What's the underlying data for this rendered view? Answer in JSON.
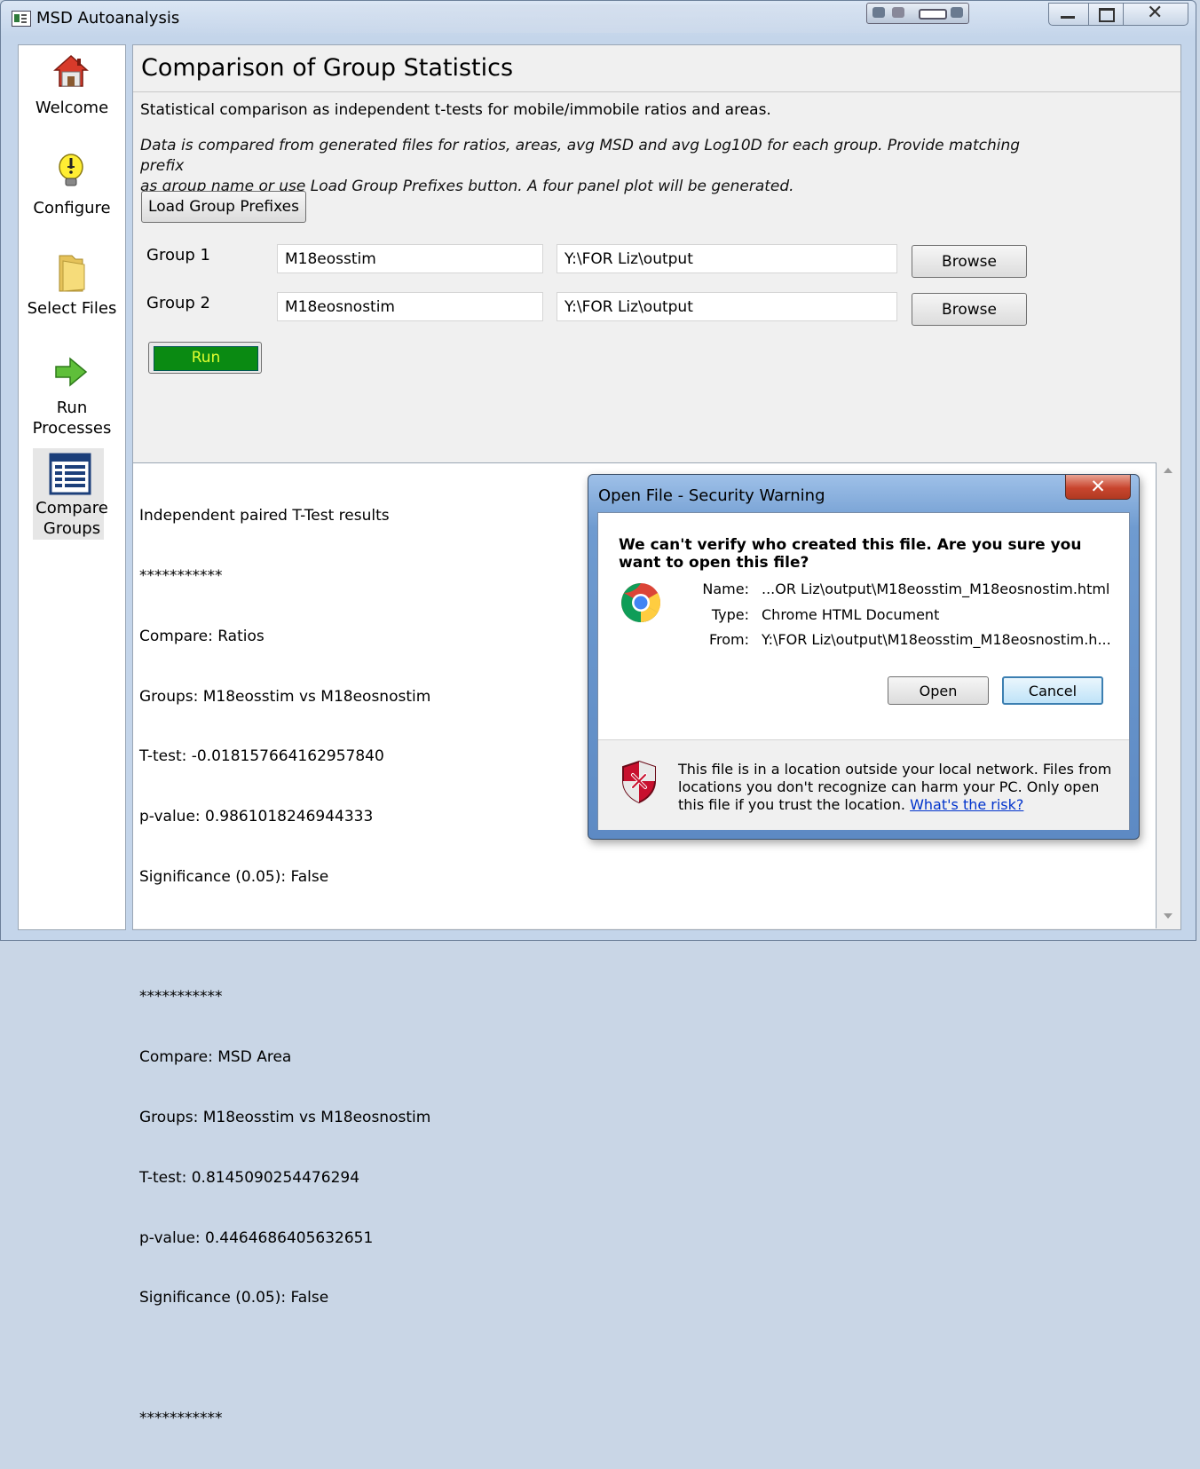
{
  "window": {
    "title": "MSD Autoanalysis"
  },
  "sidebar": {
    "items": [
      {
        "label": "Welcome",
        "icon": "house-icon"
      },
      {
        "label": "Configure",
        "icon": "lightbulb-icon"
      },
      {
        "label": "Select Files",
        "icon": "folder-icon"
      },
      {
        "label_line1": "Run",
        "label_line2": "Processes",
        "icon": "arrow-right-icon"
      },
      {
        "label_line1": "Compare",
        "label_line2": "Groups",
        "icon": "table-icon"
      }
    ]
  },
  "page": {
    "title": "Comparison of Group Statistics",
    "description": "Statistical comparison as independent t-tests for mobile/immobile ratios and areas.",
    "description_italic_line1": "Data is compared from generated files for ratios, areas, avg MSD and avg Log10D for each group. Provide matching prefix",
    "description_italic_line2": "as group name or use Load Group Prefixes button. A four panel plot will be generated.",
    "load_prefixes_label": "Load Group Prefixes",
    "groups": [
      {
        "label": "Group 1",
        "prefix": "M18eosstim",
        "folder": "Y:\\FOR Liz\\output",
        "browse_label": "Browse"
      },
      {
        "label": "Group 2",
        "prefix": "M18eosnostim",
        "folder": "Y:\\FOR Liz\\output",
        "browse_label": "Browse"
      }
    ],
    "run_label": "Run"
  },
  "output": {
    "lines": [
      "Independent paired T-Test results",
      "***********",
      "Compare: Ratios",
      "Groups: M18eosstim vs M18eosnostim",
      "T-test: -0.018157664162957840",
      "p-value: 0.9861018246944333",
      "Significance (0.05): False",
      "",
      "***********",
      "Compare: MSD Area",
      "Groups: M18eosstim vs M18eosnostim",
      "T-test: 0.8145090254476294",
      "p-value: 0.4464686405632651",
      "Significance (0.05): False",
      "",
      "***********"
    ]
  },
  "dialog": {
    "title": "Open File - Security Warning",
    "question": "We can't verify who created this file. Are you sure you want to open this file?",
    "name_key": "Name:",
    "name_value": "...OR Liz\\output\\M18eosstim_M18eosnostim.html",
    "type_key": "Type:",
    "type_value": "Chrome HTML Document",
    "from_key": "From:",
    "from_value": "Y:\\FOR Liz\\output\\M18eosstim_M18eosnostim.h...",
    "open_label": "Open",
    "cancel_label": "Cancel",
    "warning_text": "This file is in a location outside your local network. Files from locations you don't recognize can harm your PC. Only open this file if you trust the location.",
    "risk_link": "What's the risk?",
    "close_glyph": "✕"
  },
  "colors": {
    "run_green": "#0a8a12",
    "run_text": "#e0ff30",
    "link": "#0033cc"
  }
}
